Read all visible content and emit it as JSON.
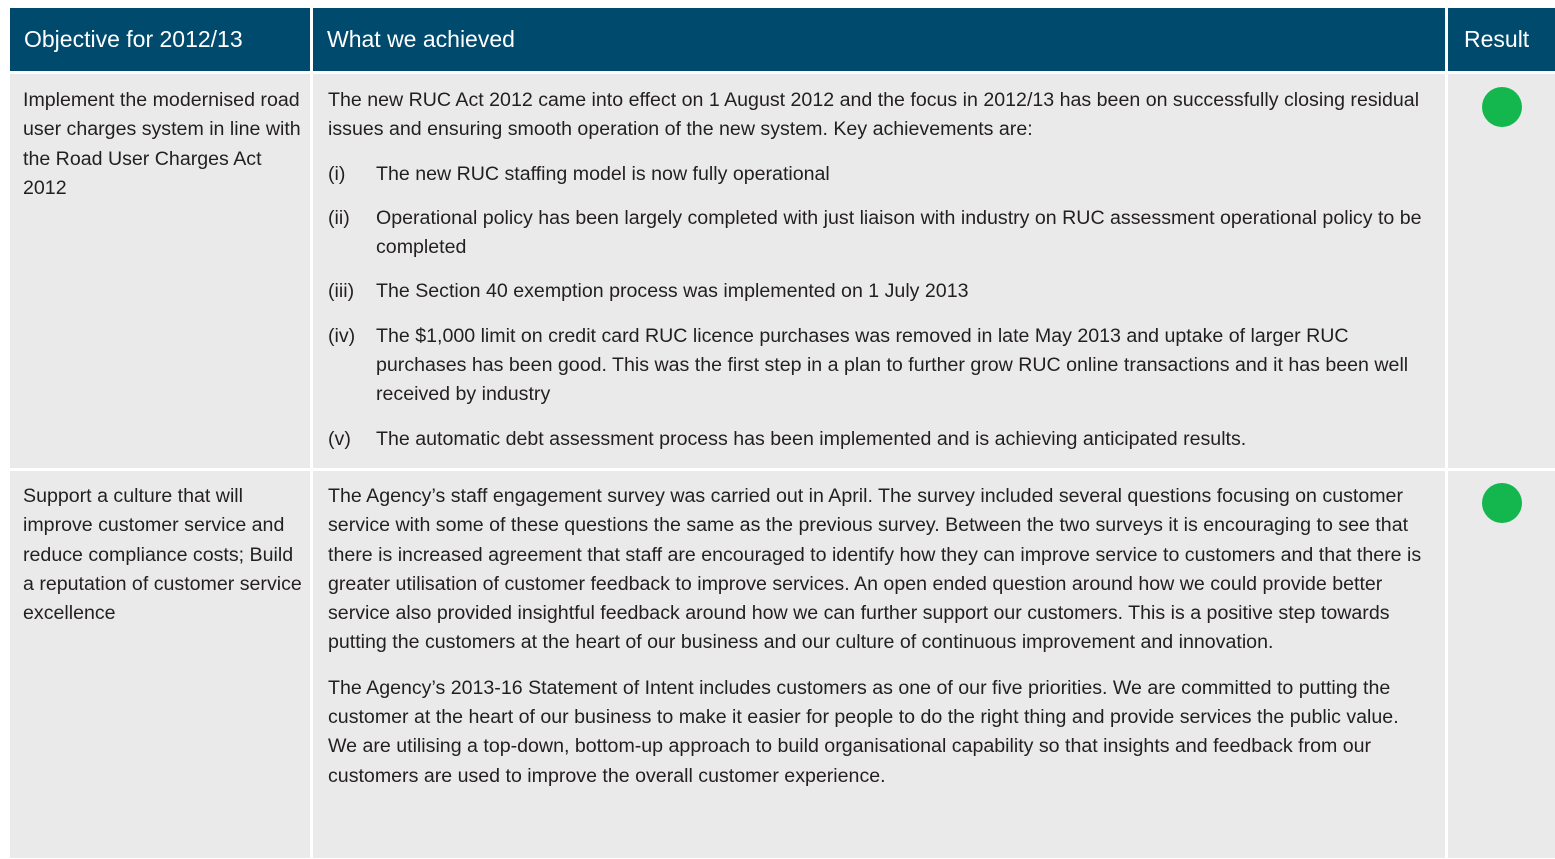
{
  "header": {
    "objective": "Objective for 2012/13",
    "achieved": "What we achieved",
    "result": "Result"
  },
  "rows": [
    {
      "objective": "Implement the modernised road user charges system in line with the Road User Charges Act 2012",
      "intro": "The new RUC Act 2012 came into effect on 1 August 2012 and the focus in 2012/13 has been on successfully closing residual issues and ensuring smooth operation of the new system. Key achievements are:",
      "items": [
        {
          "num": "(i)",
          "text": "The new RUC staffing model is now fully operational"
        },
        {
          "num": "(ii)",
          "text": "Operational policy has been largely completed with just liaison with industry on RUC assessment operational policy to be completed"
        },
        {
          "num": "(iii)",
          "text": "The Section 40 exemption process was implemented on 1 July 2013"
        },
        {
          "num": "(iv)",
          "text": "The $1,000 limit on credit card RUC licence purchases was removed in late May 2013 and uptake of larger RUC purchases has been good. This was the first step in a plan to further grow RUC online transactions and it has been well received by industry"
        },
        {
          "num": "(v)",
          "text": "The automatic debt assessment process has been implemented and is achieving anticipated results."
        }
      ],
      "result_color": "#13b74d"
    },
    {
      "objective": "Support a culture that will improve customer service and reduce compliance costs; Build a reputation of customer service excellence",
      "paragraphs": [
        "The Agency’s staff engagement survey was carried out in April. The survey included several questions focusing on customer service with some of these questions the same as the previous survey. Between the two surveys it is encouraging to see that there is increased agreement that staff are encouraged to identify how they can improve service to customers and that there is greater utilisation of customer feedback to improve services. An open ended question around how we could provide better service also provided insightful feedback around how we can further support our customers. This is a positive step towards putting the customers at the heart of our business and our culture of continuous improvement and innovation.",
        "The Agency’s 2013-16 Statement of Intent includes customers as one of our five priorities. We are committed to putting the customer at the heart of our business to make it easier for people to do the right thing and provide services the public value. We are utilising a top-down, bottom-up approach to build organisational capability so that insights and feedback from our customers are used to improve the overall customer experience."
      ],
      "result_color": "#13b74d"
    }
  ],
  "colors": {
    "header_bg": "#004a6e",
    "cell_bg": "#eaeaea",
    "status_green": "#13b74d"
  }
}
